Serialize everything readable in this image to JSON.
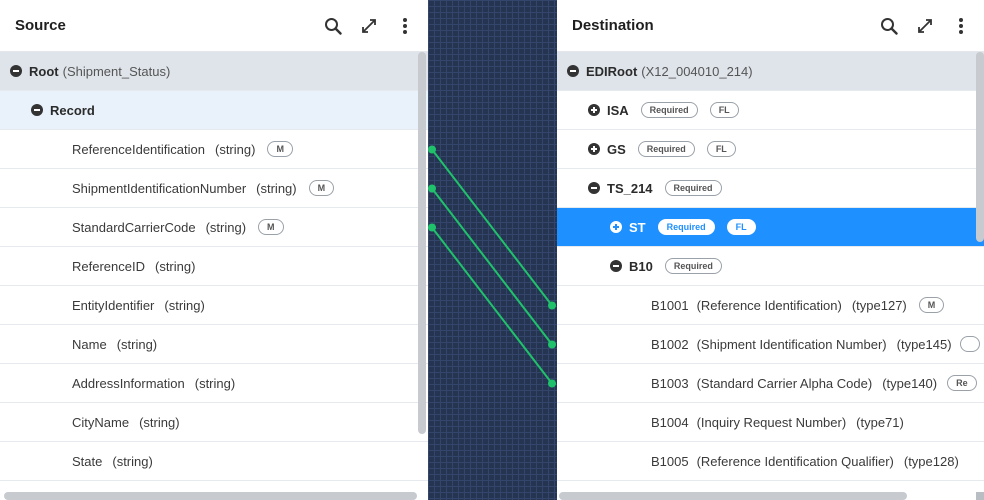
{
  "source": {
    "title": "Source",
    "root": {
      "name": "Root",
      "type": "(Shipment_Status)"
    },
    "record": {
      "name": "Record"
    },
    "fields": [
      {
        "name": "ReferenceIdentification",
        "type": "(string)",
        "badge": "M"
      },
      {
        "name": "ShipmentIdentificationNumber",
        "type": "(string)",
        "badge": "M"
      },
      {
        "name": "StandardCarrierCode",
        "type": "(string)",
        "badge": "M"
      },
      {
        "name": "ReferenceID",
        "type": "(string)",
        "badge": ""
      },
      {
        "name": "EntityIdentifier",
        "type": "(string)",
        "badge": ""
      },
      {
        "name": "Name",
        "type": "(string)",
        "badge": ""
      },
      {
        "name": "AddressInformation",
        "type": "(string)",
        "badge": ""
      },
      {
        "name": "CityName",
        "type": "(string)",
        "badge": ""
      },
      {
        "name": "State",
        "type": "(string)",
        "badge": ""
      }
    ]
  },
  "destination": {
    "title": "Destination",
    "root": {
      "name": "EDIRoot",
      "type": "(X12_004010_214)"
    },
    "segments": [
      {
        "name": "ISA",
        "badge1": "Required",
        "badge2": "FL"
      },
      {
        "name": "GS",
        "badge1": "Required",
        "badge2": "FL"
      },
      {
        "name": "TS_214",
        "badge1": "Required"
      },
      {
        "name": "ST",
        "badge1": "Required",
        "badge2": "FL"
      },
      {
        "name": "B10",
        "badge1": "Required"
      }
    ],
    "elements": [
      {
        "id": "B1001",
        "desc": "(Reference Identification)",
        "type": "(type127)",
        "badge": "M"
      },
      {
        "id": "B1002",
        "desc": "(Shipment Identification Number)",
        "type": "(type145)",
        "badge": ""
      },
      {
        "id": "B1003",
        "desc": "(Standard Carrier Alpha Code)",
        "type": "(type140)",
        "badge": "Re"
      },
      {
        "id": "B1004",
        "desc": "(Inquiry Request Number)",
        "type": "(type71)",
        "badge": ""
      },
      {
        "id": "B1005",
        "desc": "(Reference Identification Qualifier)",
        "type": "(type128)",
        "badge": ""
      }
    ]
  },
  "mappings": [
    {
      "from": "ReferenceIdentification",
      "to": "B1001"
    },
    {
      "from": "ShipmentIdentificationNumber",
      "to": "B1002"
    },
    {
      "from": "StandardCarrierCode",
      "to": "B1003"
    }
  ],
  "colors": {
    "wire": "#1fc26a",
    "selected": "#1e90ff",
    "gutter": "#253551"
  },
  "icons": [
    "search-icon",
    "expand-icon",
    "more-vertical-icon"
  ]
}
